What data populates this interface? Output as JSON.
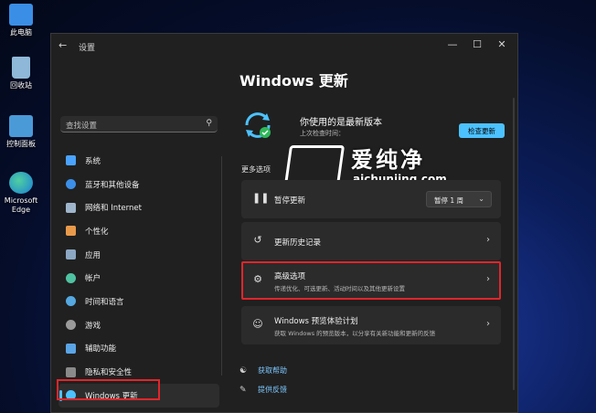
{
  "desktop": {
    "icons": [
      {
        "label": "此电脑",
        "color": "#3a8ee6"
      },
      {
        "label": "回收站",
        "color": "#8fb8d8"
      },
      {
        "label": "控制面板",
        "color": "#4a9ad8"
      },
      {
        "label": "Microsoft Edge",
        "color": "#2aa86b"
      }
    ]
  },
  "window": {
    "app_title": "设置",
    "back": "←",
    "minimize": "—",
    "maximize": "☐",
    "close": "✕"
  },
  "search": {
    "placeholder": "查找设置",
    "icon": "search-icon"
  },
  "sidebar": {
    "items": [
      {
        "label": "系统",
        "icon_color": "#4aa3ff"
      },
      {
        "label": "蓝牙和其他设备",
        "icon_color": "#3b8fe8"
      },
      {
        "label": "网络和 Internet",
        "icon_color": "#9fb5cc"
      },
      {
        "label": "个性化",
        "icon_color": "#e89a4a"
      },
      {
        "label": "应用",
        "icon_color": "#8ba7c2"
      },
      {
        "label": "帐户",
        "icon_color": "#4fc3a1"
      },
      {
        "label": "时间和语言",
        "icon_color": "#56a8e0"
      },
      {
        "label": "游戏",
        "icon_color": "#9a9a9a"
      },
      {
        "label": "辅助功能",
        "icon_color": "#5aa5e6"
      },
      {
        "label": "隐私和安全性",
        "icon_color": "#8a8a8a"
      },
      {
        "label": "Windows 更新",
        "icon_color": "#4cc2ff"
      }
    ],
    "active_index": 10
  },
  "main": {
    "title": "Windows 更新",
    "status": {
      "heading": "你使用的是最新版本",
      "sub": "上次检查时间：",
      "check_button": "检查更新"
    },
    "watermark": {
      "cn": "爱纯净",
      "en": "aichunjing.com"
    },
    "section_label": "更多选项",
    "cards": [
      {
        "title": "暂停更新",
        "icon": "pause-icon",
        "dropdown": "暂停 1 周"
      },
      {
        "title": "更新历史记录",
        "icon": "history-icon"
      },
      {
        "title": "高级选项",
        "icon": "gears-icon",
        "sub": "传递优化、可选更新、活动时间以及其他更新设置"
      },
      {
        "title": "Windows 预览体验计划",
        "icon": "insider-icon",
        "sub": "获取 Windows 的预览版本，以分享有关新功能和更新的反馈"
      }
    ],
    "links": [
      {
        "label": "获取帮助",
        "icon": "help-icon"
      },
      {
        "label": "提供反馈",
        "icon": "feedback-icon"
      }
    ]
  },
  "colors": {
    "accent": "#4cc2ff",
    "highlight_red": "#e0262b",
    "window_bg": "#202020",
    "card_bg": "#2b2b2b"
  }
}
